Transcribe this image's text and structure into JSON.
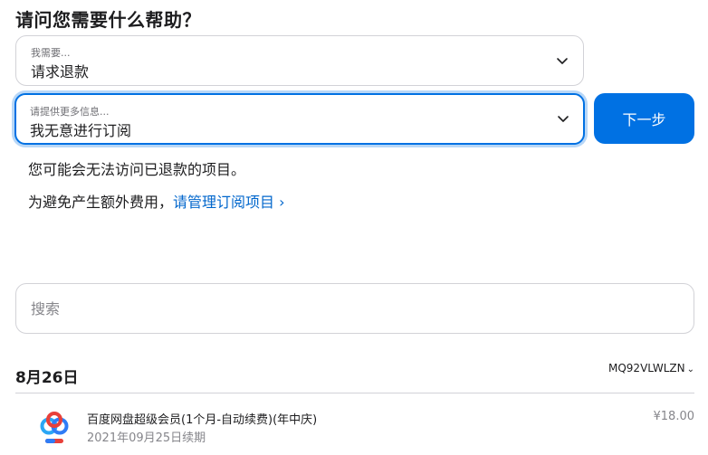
{
  "heading": "请问您需要什么帮助？",
  "reason_select": {
    "label": "我需要...",
    "value": "请求退款",
    "icon": "chevron-down-icon"
  },
  "detail_select": {
    "label": "请提供更多信息...",
    "value": "我无意进行订阅",
    "icon": "chevron-down-icon"
  },
  "next_button": "下一步",
  "info": {
    "line1": "您可能会无法访问已退款的项目。",
    "line2_prefix": "为避免产生额外费用，",
    "line2_link": "请管理订阅项目 ›"
  },
  "search": {
    "placeholder": "搜索",
    "value": ""
  },
  "order": {
    "date": "8月26日",
    "id": "MQ92VLWLZN",
    "id_caret": "⌄"
  },
  "items": [
    {
      "icon": "baidu-netdisk-icon",
      "title": "百度网盘超级会员(1个月-自动续费)(年中庆)",
      "subtitle": "2021年09月25日续期",
      "price": "¥18.00"
    }
  ],
  "colors": {
    "accent": "#0071e3",
    "link": "#0066cc",
    "border": "#d2d2d7",
    "muted": "#86868b"
  }
}
